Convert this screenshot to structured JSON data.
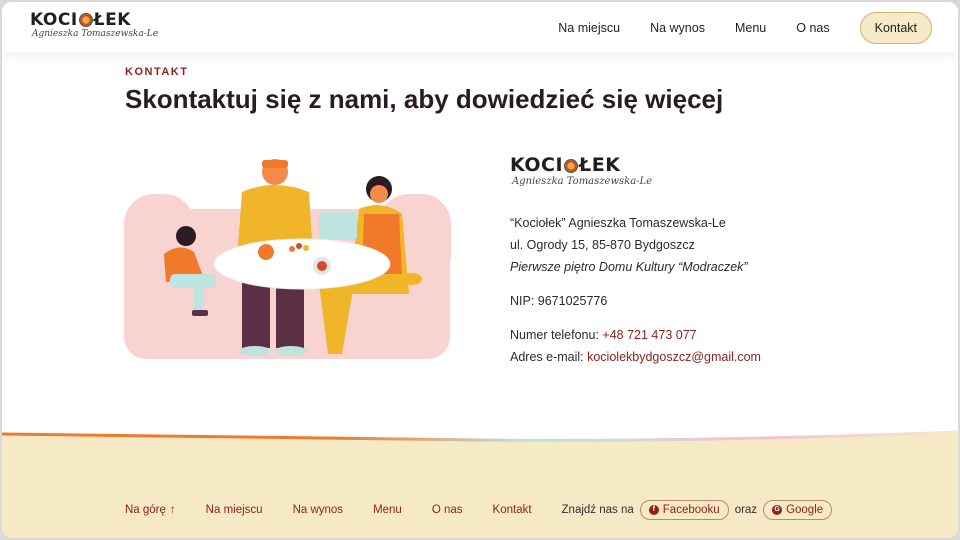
{
  "header": {
    "logo_word_left": "KOCI",
    "logo_word_right": "ŁEK",
    "logo_script": "Agnieszka Tomaszewska-Le",
    "nav": [
      "Na miejscu",
      "Na wynos",
      "Menu",
      "O nas"
    ],
    "cta": "Kontakt"
  },
  "main": {
    "eyebrow": "KONTAKT",
    "title": "Skontaktuj się z nami, aby dowiedzieć się więcej"
  },
  "contact": {
    "logo_word_left": "KOCI",
    "logo_word_right": "ŁEK",
    "logo_script": "Agnieszka Tomaszewska-Le",
    "company": "“Kociołek” Agnieszka Tomaszewska-Le",
    "address": "ul. Ogrody 15, 85-870 Bydgoszcz",
    "location_note": "Pierwsze piętro Domu Kultury “Modraczek”",
    "nip": "NIP: 9671025776",
    "phone_label": "Numer telefonu: ",
    "phone": "+48 721 473 077",
    "email_label": "Adres e-mail: ",
    "email": "kociolekbydgoszcz@gmail.com"
  },
  "footer": {
    "back_to_top": "Na górę",
    "links": [
      "Na miejscu",
      "Na wynos",
      "Menu",
      "O nas",
      "Kontakt"
    ],
    "find_us": "Znajdź nas na",
    "facebook": "Facebooku",
    "or": "oraz",
    "google": "Google"
  },
  "colors": {
    "accent": "#8f1f1f",
    "cta_bg": "#f7ebc7",
    "footer_bg": "#f6e9c5",
    "title": "#2a1a22"
  },
  "icons": {
    "logo_mark": "pot-logo-icon",
    "back_to_top": "arrow-up-icon",
    "facebook": "facebook-icon",
    "google": "google-icon"
  }
}
